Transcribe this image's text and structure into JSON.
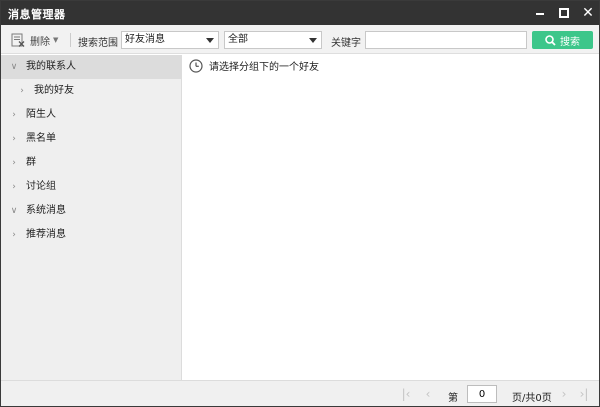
{
  "window": {
    "title": "消息管理器",
    "minimize_icon": "minimize-icon",
    "maximize_icon": "maximize-icon",
    "close_icon": "close-icon"
  },
  "toolbar": {
    "delete_label": "删除",
    "scope_label": "搜索范围",
    "scope_value": "好友消息",
    "range_value": "全部",
    "keyword_label": "关键字",
    "keyword_value": "",
    "keyword_placeholder": "",
    "search_label": "搜索"
  },
  "sidebar": {
    "items": [
      {
        "label": "我的联系人",
        "expanded": true,
        "selected": true
      },
      {
        "label": "我的好友",
        "expanded": false,
        "child": true
      },
      {
        "label": "陌生人",
        "expanded": false
      },
      {
        "label": "黑名单",
        "expanded": false
      },
      {
        "label": "群",
        "expanded": false
      },
      {
        "label": "讨论组",
        "expanded": false
      },
      {
        "label": "系统消息",
        "expanded": true
      },
      {
        "label": "推荐消息",
        "expanded": false
      }
    ]
  },
  "main": {
    "hint": "请选择分组下的一个好友"
  },
  "footer": {
    "page_label": "第",
    "page_value": "0",
    "total_label": "页/共0页"
  },
  "colors": {
    "titlebar": "#333333",
    "search_button": "#3cc68a",
    "sidebar_bg": "#efefef",
    "selected_bg": "#dcdcdc"
  }
}
